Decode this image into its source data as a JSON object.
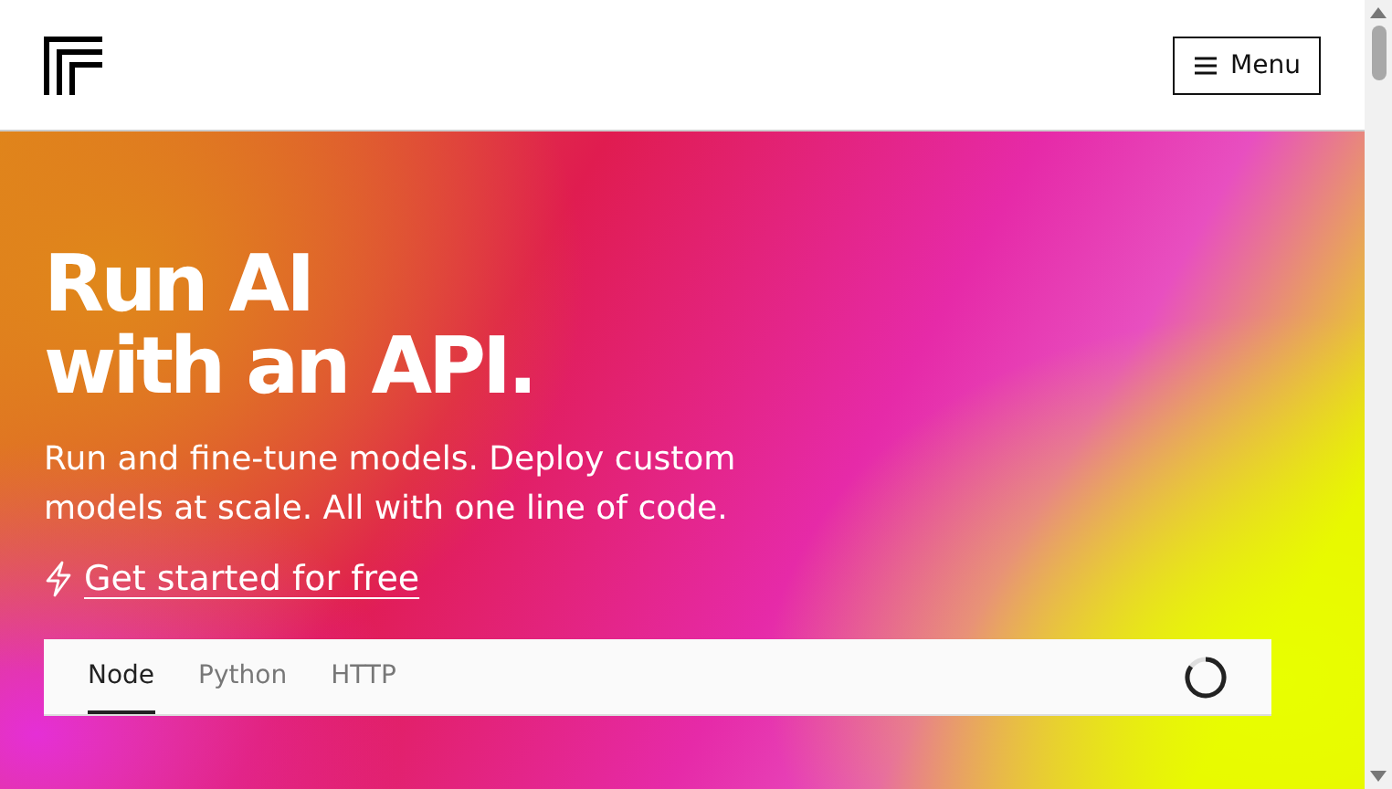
{
  "header": {
    "menu_button": "Menu"
  },
  "hero": {
    "title_lines": [
      "Run AI",
      "with an API."
    ],
    "subtitle": "Run and fine-tune models. Deploy custom models at scale. All with one line of code.",
    "cta": "Get started for free"
  },
  "code_tabs": [
    {
      "label": "Node",
      "selected": true
    },
    {
      "label": "Python",
      "selected": false
    },
    {
      "label": "HTTP",
      "selected": false
    }
  ]
}
